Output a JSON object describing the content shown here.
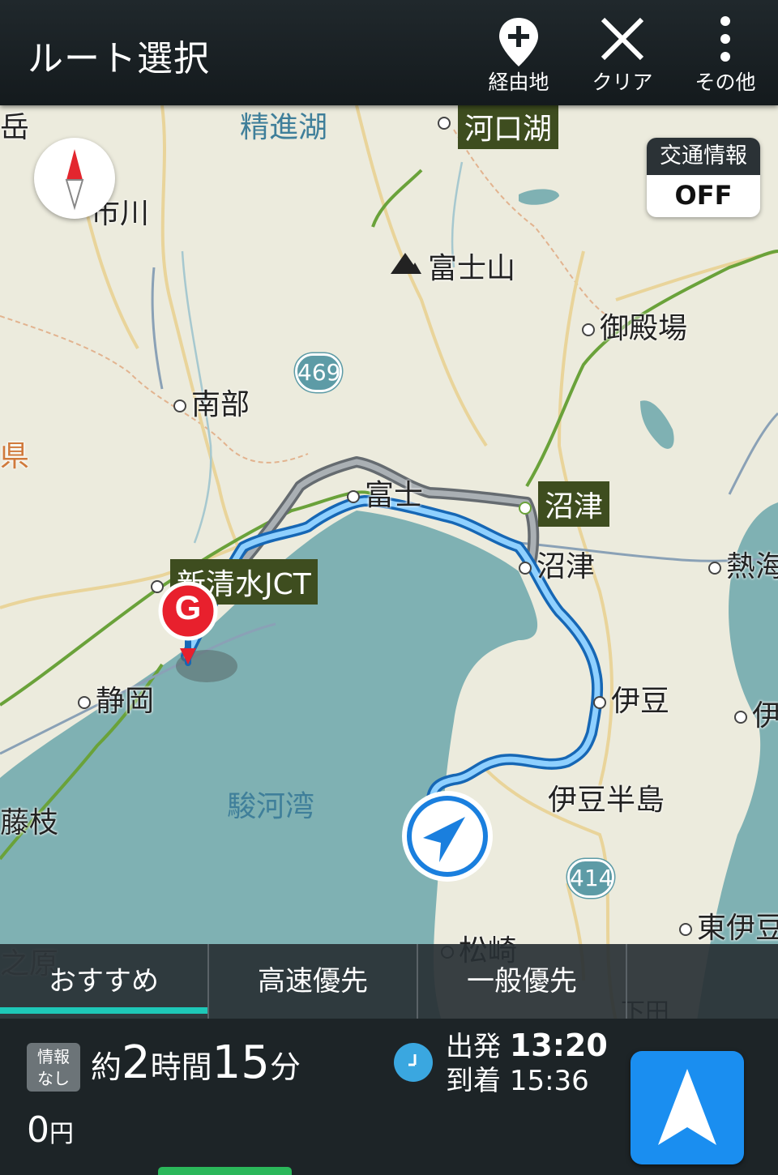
{
  "header": {
    "title": "ルート選択",
    "actions": [
      {
        "label": "経由地",
        "icon": "add-waypoint-icon"
      },
      {
        "label": "クリア",
        "icon": "close-icon"
      },
      {
        "label": "その他",
        "icon": "more-vertical-icon"
      }
    ]
  },
  "map": {
    "traffic": {
      "label": "交通情報",
      "state": "OFF"
    },
    "places": {
      "shojiko": "精進湖",
      "kawaguchiko": "河口湖",
      "fujisan": "富士山",
      "gotemba": "御殿場",
      "nanbu": "南部",
      "fuji": "富士",
      "numazu_green": "沼津",
      "numazu": "沼津",
      "atami": "熱海",
      "shinshimizu": "新清水JCT",
      "shizuoka": "静岡",
      "izu": "伊豆",
      "izuhanto": "伊豆半島",
      "surugawan": "駿河湾",
      "fujieda": "藤枝",
      "matsuzaki": "松崎",
      "higashiizu": "東伊豆",
      "ichikawa": "市川",
      "ito": "伊",
      "edge_left": "県",
      "edge_top": "岳",
      "omaezaki": "之原",
      "shimoda": "下田"
    },
    "route_shields": [
      "469",
      "414"
    ],
    "goal_marker": "G",
    "colors": {
      "route": "#3aa3f0",
      "alt_route": "#8f9498",
      "water": "#7fb1b3",
      "land": "#ecebdd"
    }
  },
  "tabs": [
    {
      "label": "おすすめ",
      "active": true
    },
    {
      "label": "高速優先",
      "active": false
    },
    {
      "label": "一般優先",
      "active": false
    }
  ],
  "summary": {
    "badge_line1": "情報",
    "badge_line2": "なし",
    "dur_prefix": "約",
    "dur_hours": "2",
    "dur_h_unit": "時間",
    "dur_minutes": "15",
    "dur_m_unit": "分",
    "depart_label": "出発",
    "depart_time": "13:20",
    "arrive_label": "到着",
    "arrive_time": "15:36",
    "toll_value": "0",
    "toll_unit": "円"
  }
}
